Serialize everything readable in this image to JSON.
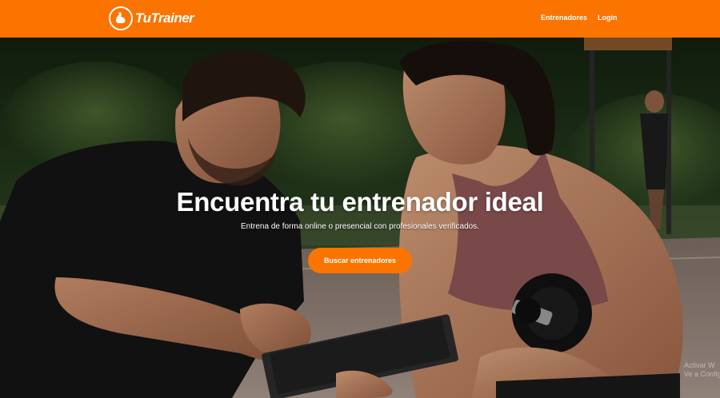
{
  "header": {
    "brand_name": "TuTrainer",
    "nav": {
      "trainers_label": "Entrenadores",
      "login_label": "Login"
    }
  },
  "hero": {
    "title": "Encuentra tu entrenador ideal",
    "subtitle": "Entrena de forma online o presencial con profesionales verificados.",
    "cta_label": "Buscar entrenadores"
  },
  "watermark": {
    "line1": "Activar W",
    "line2": "Ve a Config"
  },
  "colors": {
    "brand": "#fb7400",
    "text_on_brand": "#ffffff"
  }
}
